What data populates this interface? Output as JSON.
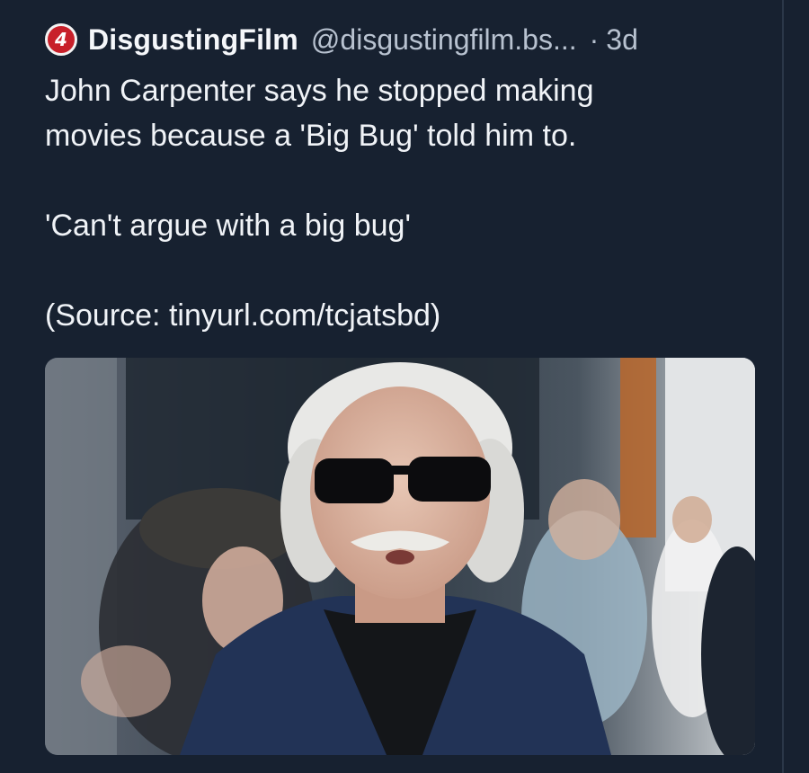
{
  "post": {
    "display_name": "DisgustingFilm",
    "handle": "@disgustingfilm.bs...",
    "separator": "·",
    "time": "3d",
    "avatar_glyph": "4",
    "lines": [
      "John Carpenter says he stopped making",
      "movies because a 'Big Bug' told him to.",
      "'Can't argue with a big bug'",
      "(Source: tinyurl.com/tcjatsbd)"
    ],
    "image_icon": "photo-of-man-in-sunglasses"
  },
  "colors": {
    "background": "#172130",
    "avatar": "#c8202a",
    "muted_text": "#b8c2d0"
  }
}
